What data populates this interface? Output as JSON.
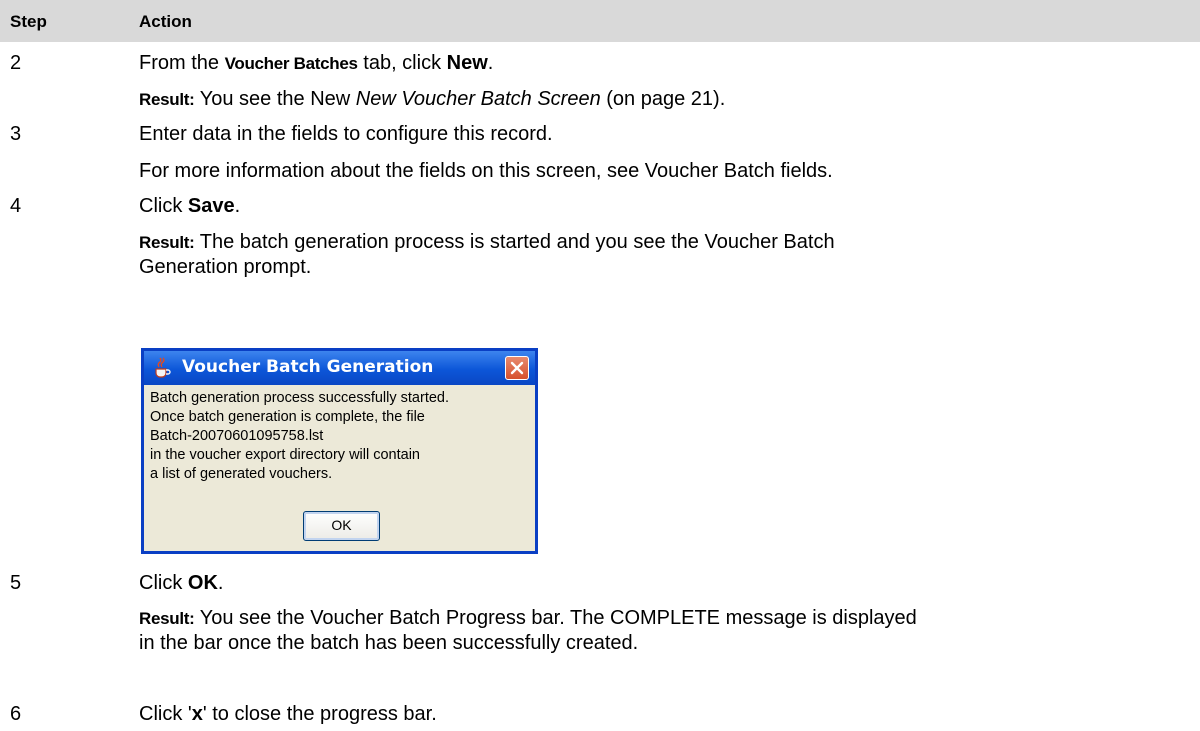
{
  "table": {
    "header": {
      "step": "Step",
      "action": "Action"
    }
  },
  "rows": {
    "r2": {
      "num": "2",
      "a_pre": "From the ",
      "a_bold": "Voucher Batches",
      "a_mid": " tab, click ",
      "a_bold2": "New",
      "a_post": ".",
      "res_label": "Result:",
      "res_pre": " You see the New ",
      "res_link": "New Voucher Batch Screen",
      "res_post": " (on page 21)."
    },
    "r3": {
      "num": "3",
      "a": "Enter data in the fields to configure this record.",
      "b": "For more information about the fields on this screen, see Voucher Batch fields."
    },
    "r4": {
      "num": "4",
      "a_pre": "Click ",
      "a_bold": "Save",
      "a_post": ".",
      "res_label": "Result:",
      "res_line1": " The batch generation process is started and you see the Voucher Batch",
      "res_line2": "Generation prompt."
    },
    "r5": {
      "num": "5",
      "a_pre": "Click ",
      "a_bold": "OK",
      "a_post": ".",
      "res_label": "Result:",
      "res_line1": " You see the Voucher Batch Progress bar. The COMPLETE message is displayed",
      "res_line2": "in the bar once the batch has been successfully created."
    },
    "r6": {
      "num": "6",
      "a_pre": "Click '",
      "a_bold": "x",
      "a_post": "' to close the progress bar."
    }
  },
  "dialog": {
    "title": "Voucher Batch Generation",
    "lines": [
      "Batch generation process successfully started.",
      "Once batch generation is complete, the file",
      "Batch-20070601095758.lst",
      "in the voucher export directory will contain",
      "a list of generated vouchers."
    ],
    "ok_label": "OK",
    "icons": {
      "title": "java-cup-icon",
      "close": "close-x-icon"
    },
    "colors": {
      "titlebar": "#0c56d8",
      "close": "#d6502c",
      "body": "#ece9d8"
    }
  },
  "colors": {
    "header_bg": "#d9d9d9"
  }
}
